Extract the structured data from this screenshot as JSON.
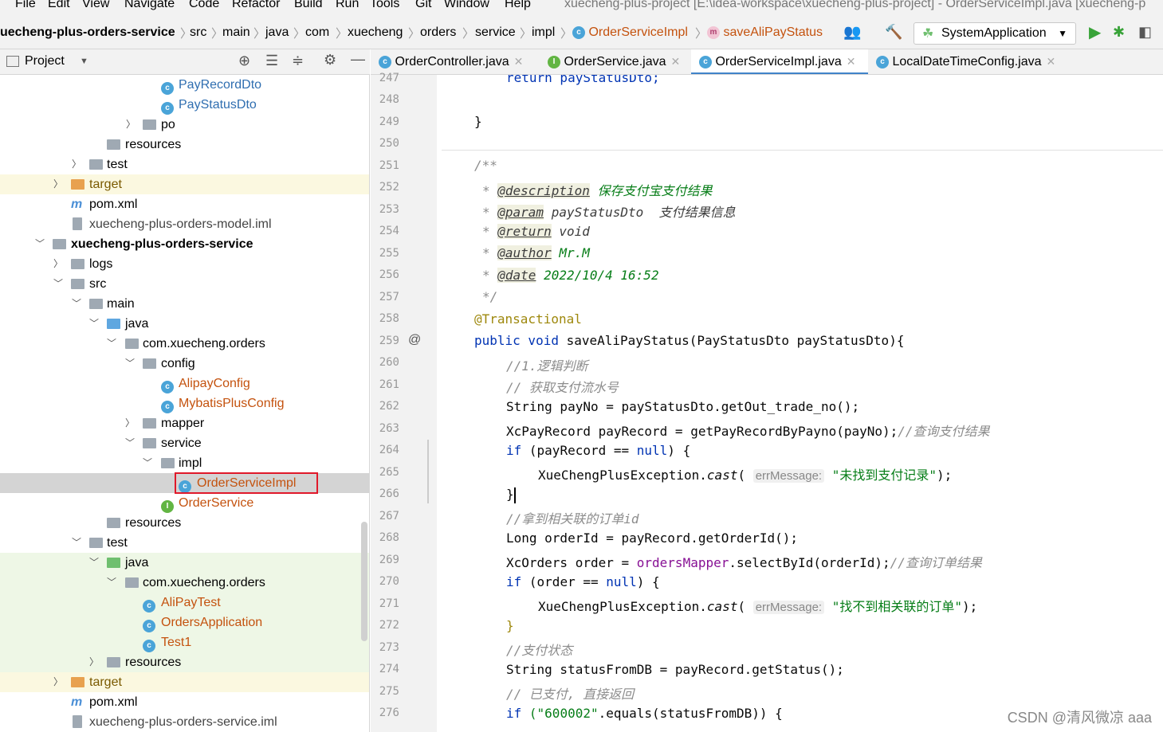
{
  "menu": [
    "File",
    "Edit",
    "View",
    "Navigate",
    "Code",
    "Refactor",
    "Build",
    "Run",
    "Tools",
    "Git",
    "Window",
    "Help"
  ],
  "window_title": "xuecheng-plus-project [E:\\idea-workspace\\xuecheng-plus-project] - OrderServiceImpl.java [xuecheng-p",
  "breadcrumbs": [
    "uecheng-plus-orders-service",
    "src",
    "main",
    "java",
    "com",
    "xuecheng",
    "orders",
    "service",
    "impl",
    "OrderServiceImpl",
    "saveAliPayStatus"
  ],
  "run_config": "SystemApplication",
  "project_panel_title": "Project",
  "tabs": [
    "OrderController.java",
    "OrderService.java",
    "OrderServiceImpl.java",
    "LocalDateTimeConfig.java"
  ],
  "tree": [
    {
      "label": "PayRecordDto",
      "type": "class"
    },
    {
      "label": "PayStatusDto",
      "type": "class"
    },
    {
      "label": "po",
      "type": "package"
    },
    {
      "label": "resources",
      "type": "folder"
    },
    {
      "label": "test",
      "type": "folder"
    },
    {
      "label": "target",
      "type": "folder-orange"
    },
    {
      "label": "pom.xml",
      "type": "maven"
    },
    {
      "label": "xuecheng-plus-orders-model.iml",
      "type": "iml"
    },
    {
      "label": "xuecheng-plus-orders-service",
      "type": "module"
    },
    {
      "label": "logs",
      "type": "folder"
    },
    {
      "label": "src",
      "type": "folder"
    },
    {
      "label": "main",
      "type": "folder"
    },
    {
      "label": "java",
      "type": "folder-blue"
    },
    {
      "label": "com.xuecheng.orders",
      "type": "package"
    },
    {
      "label": "config",
      "type": "package"
    },
    {
      "label": "AlipayConfig",
      "type": "class"
    },
    {
      "label": "MybatisPlusConfig",
      "type": "class"
    },
    {
      "label": "mapper",
      "type": "package"
    },
    {
      "label": "service",
      "type": "package"
    },
    {
      "label": "impl",
      "type": "package"
    },
    {
      "label": "OrderServiceImpl",
      "type": "class"
    },
    {
      "label": "OrderService",
      "type": "interface"
    },
    {
      "label": "resources",
      "type": "folder"
    },
    {
      "label": "test",
      "type": "folder"
    },
    {
      "label": "java",
      "type": "folder-green"
    },
    {
      "label": "com.xuecheng.orders",
      "type": "package"
    },
    {
      "label": "AliPayTest",
      "type": "test"
    },
    {
      "label": "OrdersApplication",
      "type": "test"
    },
    {
      "label": "Test1",
      "type": "test"
    },
    {
      "label": "resources",
      "type": "folder"
    },
    {
      "label": "target",
      "type": "folder-orange"
    },
    {
      "label": "pom.xml",
      "type": "maven"
    },
    {
      "label": "xuecheng-plus-orders-service.iml",
      "type": "iml"
    }
  ],
  "line_numbers": [
    "247",
    "248",
    "249",
    "250",
    "251",
    "252",
    "253",
    "254",
    "255",
    "256",
    "257",
    "258",
    "259",
    "260",
    "261",
    "262",
    "263",
    "264",
    "265",
    "266",
    "267",
    "268",
    "269",
    "270",
    "271",
    "272",
    "273",
    "274",
    "275",
    "276"
  ],
  "code": {
    "l247": "return payStatusDto;",
    "l249": "}",
    "l251": "/**",
    "l252_tag": "@description",
    "l252_text": "保存支付宝支付结果",
    "l253_tag": "@param",
    "l253_text": "payStatusDto  支付结果信息",
    "l254_tag": "@return",
    "l254_text": "void",
    "l255_tag": "@author",
    "l255_text": "Mr.M",
    "l256_tag": "@date",
    "l256_text": "2022/10/4 16:52",
    "l257": "*/",
    "l258": "@Transactional",
    "l259_kw": "public void",
    "l259_rest": "saveAliPayStatus(PayStatusDto payStatusDto){",
    "l260": "//1.逻辑判断",
    "l261": "// 获取支付流水号",
    "l262": "String payNo = payStatusDto.getOut_trade_no();",
    "l263_code": "XcPayRecord payRecord = getPayRecordByPayno(payNo);",
    "l263_cmt": "//查询支付结果",
    "l264_kw": "if",
    "l264_rest": "(payRecord == ",
    "l264_null": "null",
    "l264_end": ") {",
    "l265_pre": "XueChengPlusException.",
    "l265_m": "cast",
    "l265_hint": "errMessage:",
    "l265_str": "\"未找到支付记录\"",
    "l265_end": ");",
    "l266": "}",
    "l267": "//拿到相关联的订单id",
    "l268": "Long orderId = payRecord.getOrderId();",
    "l269_pre": "XcOrders order = ",
    "l269_fld": "ordersMapper",
    "l269_rest": ".selectById(orderId);",
    "l269_cmt": "//查询订单结果",
    "l270_kw": "if",
    "l270_rest": "(order == ",
    "l270_null": "null",
    "l270_end": ") {",
    "l271_pre": "XueChengPlusException.",
    "l271_m": "cast",
    "l271_hint": "errMessage:",
    "l271_str": "\"找不到相关联的订单\"",
    "l271_end": ");",
    "l272": "}",
    "l273": "//支付状态",
    "l274": "String statusFromDB = payRecord.getStatus();",
    "l275": "// 已支付, 直接返回",
    "l276_kw": "if",
    "l276_str": "(\"600002\"",
    "l276_rest": ".equals(statusFromDB)) {"
  },
  "watermark": "CSDN @清风微凉 aaa"
}
